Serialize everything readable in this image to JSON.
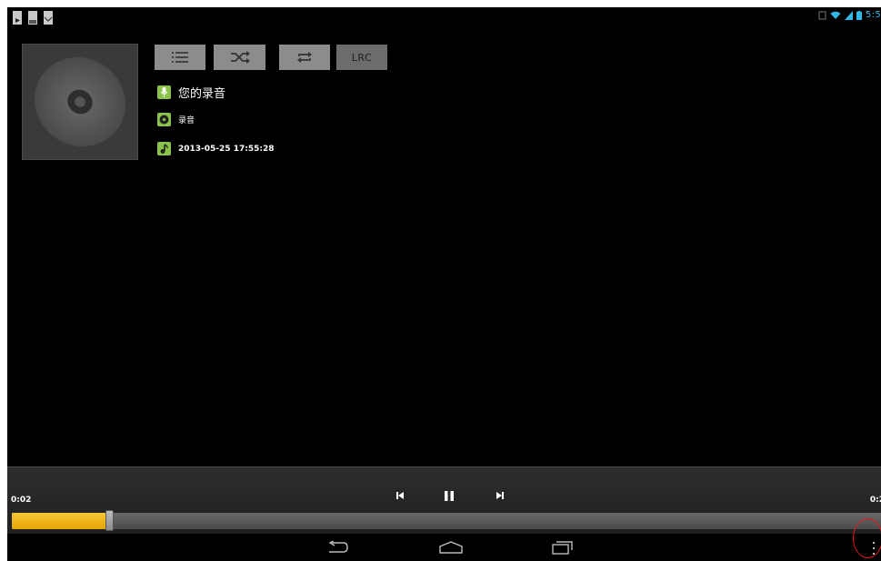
{
  "status_bar": {
    "clock": "5:5",
    "left_icons": [
      "play-notification-icon",
      "image-notification-icon",
      "gmail-notification-icon"
    ],
    "right_icons": [
      "sync-icon",
      "wifi-icon",
      "signal-icon",
      "battery-icon"
    ],
    "clock_color": "#33b5e5"
  },
  "controls": {
    "playlist_icon": "list-icon",
    "shuffle_icon": "shuffle-icon",
    "repeat_icon": "repeat-icon",
    "lrc_label": "LRC"
  },
  "track": {
    "title": "您的录音",
    "album": "录音",
    "date": "2013-05-25 17:55:28"
  },
  "playback": {
    "elapsed": "0:02",
    "total": "0:2",
    "progress": 0.11,
    "accent_color": "#f3b71f"
  },
  "navigation": {
    "back_icon": "back-icon",
    "home_icon": "home-icon",
    "recents_icon": "recent-apps-icon",
    "menu_icon": "overflow-menu-icon"
  }
}
